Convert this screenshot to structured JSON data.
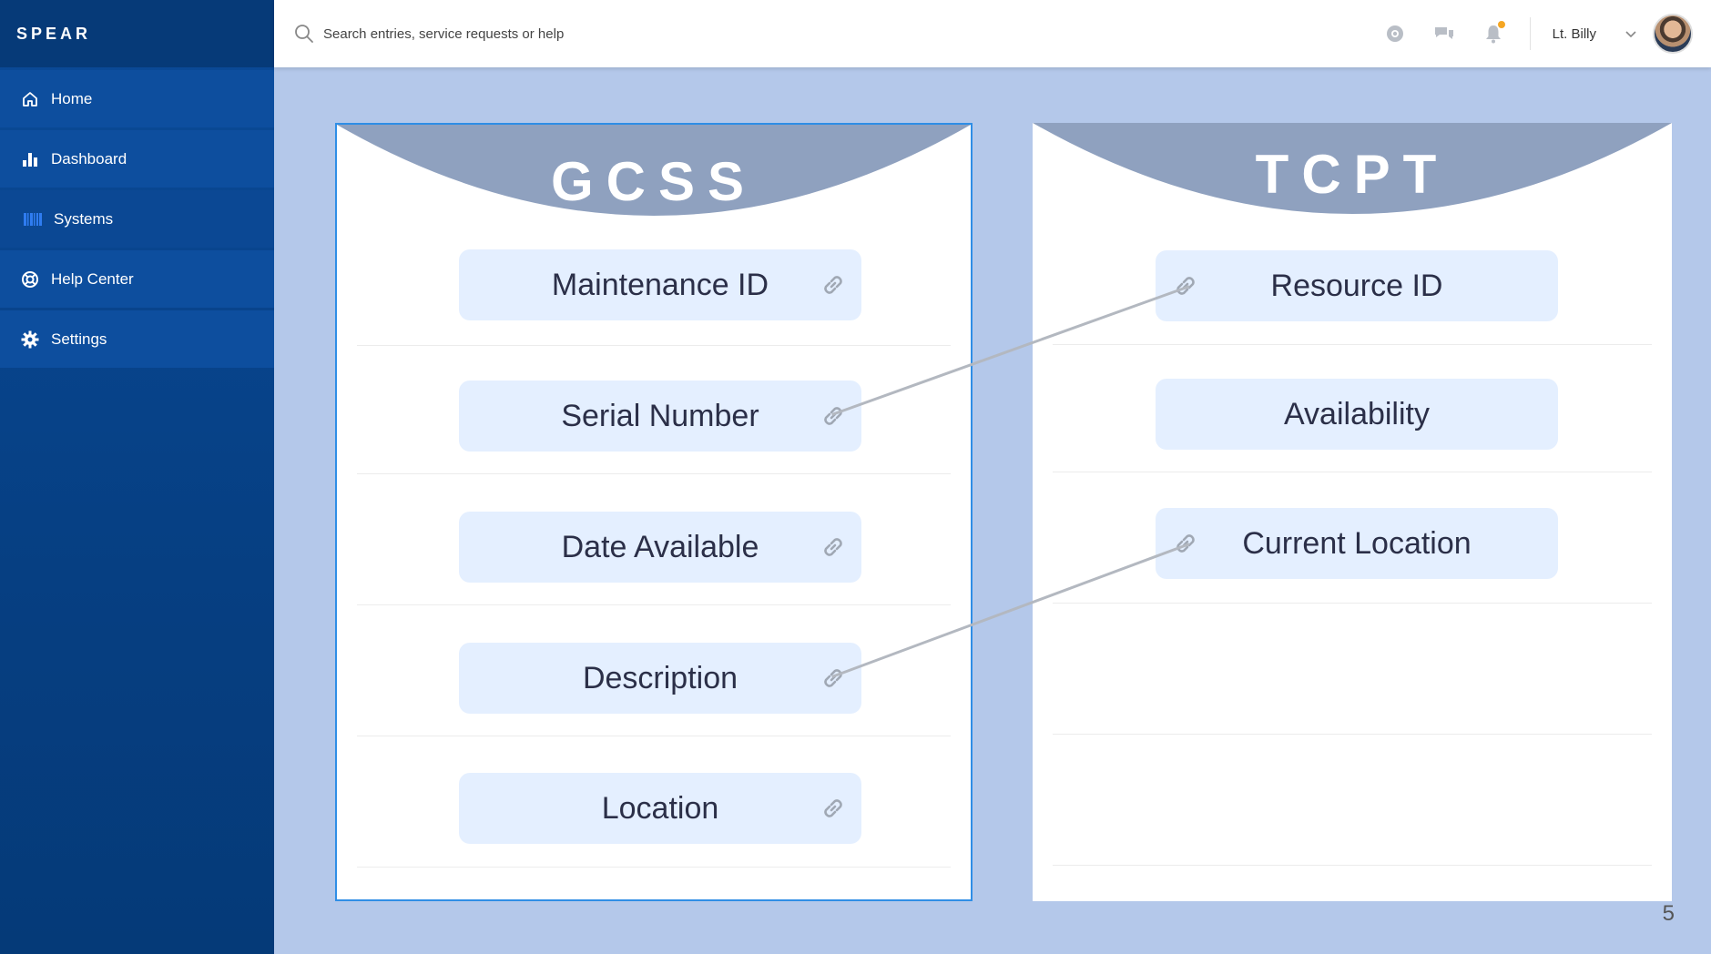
{
  "app": {
    "brand": "SPEAR"
  },
  "sidebar": {
    "items": [
      {
        "label": "Home",
        "icon": "home-icon"
      },
      {
        "label": "Dashboard",
        "icon": "bar-chart-icon"
      },
      {
        "label": "Systems",
        "icon": "barcode-icon",
        "active": true
      },
      {
        "label": "Help Center",
        "icon": "lifebuoy-icon"
      },
      {
        "label": "Settings",
        "icon": "gear-icon"
      }
    ]
  },
  "topbar": {
    "search": {
      "placeholder": "Search entries, service requests or help",
      "value": ""
    },
    "icons": [
      "globe-icon",
      "chat-icon",
      "bell-icon"
    ],
    "user": {
      "name": "Lt. Billy"
    }
  },
  "panels": {
    "gcss": {
      "title": "GCSS",
      "fields": [
        "Maintenance ID",
        "Serial Number",
        "Date Available",
        "Description",
        "Location"
      ]
    },
    "tcpt": {
      "title": "TCPT",
      "fields": [
        "Resource ID",
        "Availability",
        "Current Location"
      ]
    }
  },
  "mappings": [
    {
      "from": "Serial Number",
      "to": "Resource ID"
    },
    {
      "from": "Description",
      "to": "Current Location"
    }
  ],
  "colors": {
    "sidebar": "#0a4a98",
    "background": "#b4c8ea",
    "arc": "#8fa1bf",
    "field": "#e4efff",
    "notification": "#f5a623",
    "panel_border": "#2f8ee6"
  },
  "page_number": "5"
}
